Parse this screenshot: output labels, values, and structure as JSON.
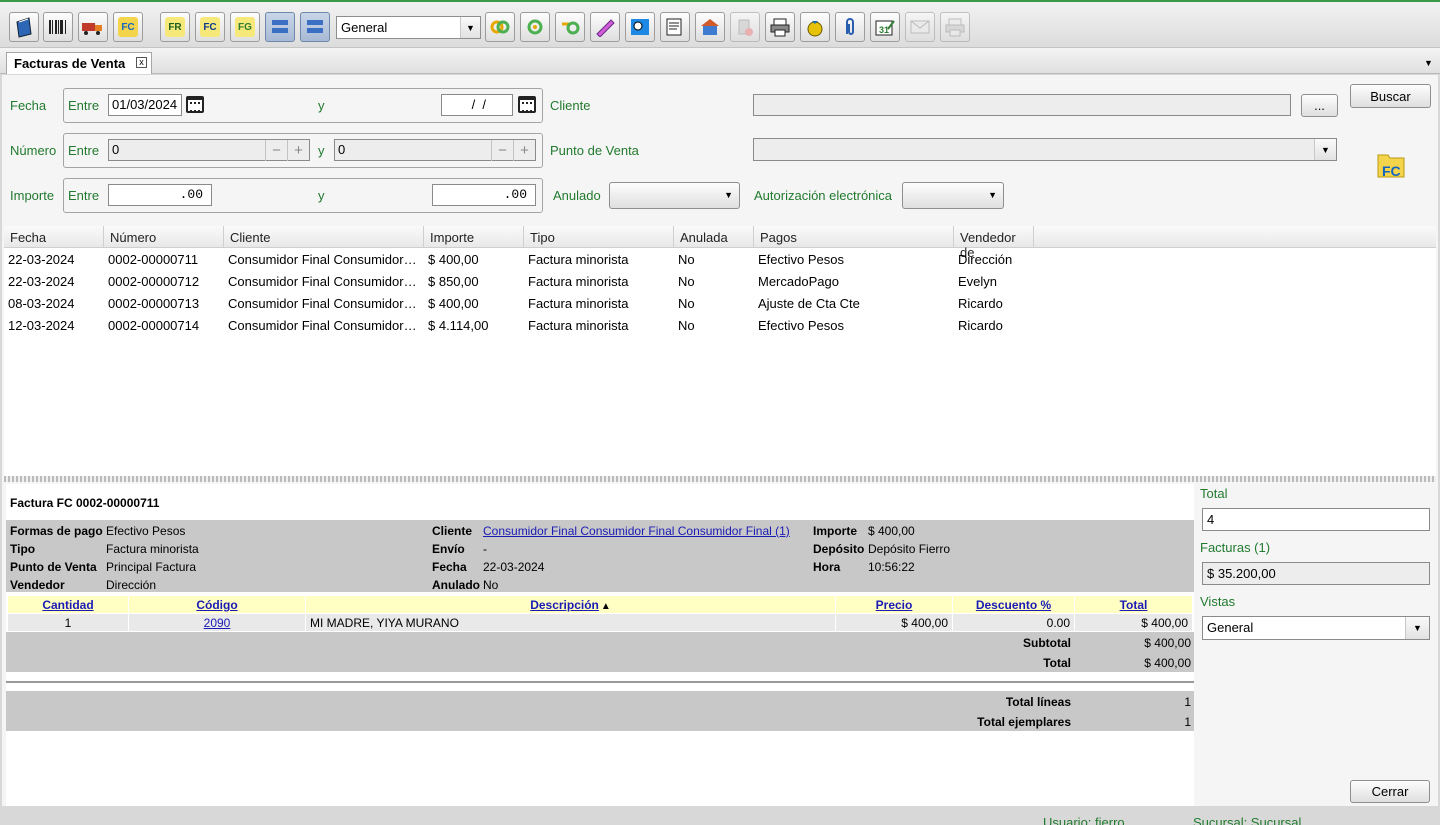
{
  "toolbar": {
    "buttons": [
      "notebook-icon",
      "barcode-icon",
      "delivery-truck-icon",
      "fc-folder-icon",
      "fr-icon",
      "fc-icon",
      "fg-icon",
      "list-view-icon",
      "list-view-alt-icon",
      "rings-icon",
      "green-circle-icon",
      "green-link-icon",
      "pen-icon",
      "map-search-icon",
      "print-preview-icon",
      "warehouse-icon",
      "delete-disabled-icon",
      "printer-icon",
      "moneybag-icon",
      "paperclip-icon",
      "calendar-edit-icon",
      "mail-disabled-icon",
      "printer-disabled-icon"
    ],
    "fr": "FR",
    "fc": "FC",
    "fg": "FG",
    "view_select": "General"
  },
  "tab": {
    "title": "Facturas de Venta",
    "close": "x"
  },
  "filters": {
    "fecha_label": "Fecha",
    "entre": "Entre",
    "y": "y",
    "fecha_from": "01/03/2024",
    "fecha_to": " /  /",
    "cliente_label": "Cliente",
    "cliente_value": "",
    "ellipsis": "...",
    "buscar": "Buscar",
    "numero_label": "Número",
    "numero_from": "0",
    "numero_to": "0",
    "punto_label": "Punto de Venta",
    "punto_value": "",
    "importe_label": "Importe",
    "importe_from": ".00",
    "importe_to": ".00",
    "anulado_label": "Anulado",
    "anulado_value": "",
    "autorizacion_label": "Autorización electrónica",
    "autorizacion_value": "",
    "fc_badge": "FC"
  },
  "grid": {
    "headers": [
      "Fecha",
      "Número",
      "Cliente",
      "Importe",
      "Tipo",
      "Anulada",
      "Pagos",
      "Vendedor de"
    ],
    "rows": [
      [
        "22-03-2024",
        "0002-00000711",
        "Consumidor Final Consumidor Final Consumidor Final",
        "$ 400,00",
        "Factura minorista",
        "No",
        "Efectivo Pesos",
        "Dirección"
      ],
      [
        "22-03-2024",
        "0002-00000712",
        "Consumidor Final Consumidor Final Consumidor Final",
        "$ 850,00",
        "Factura minorista",
        "No",
        "MercadoPago",
        "Evelyn"
      ],
      [
        "08-03-2024",
        "0002-00000713",
        "Consumidor Final Consumidor Final Consumidor Final",
        "$ 400,00",
        "Factura minorista",
        "No",
        "Ajuste de Cta Cte",
        "Ricardo"
      ],
      [
        "12-03-2024",
        "0002-00000714",
        "Consumidor Final Consumidor Final Consumidor Final",
        "$ 4.114,00",
        "Factura minorista",
        "No",
        "Efectivo Pesos",
        "Ricardo"
      ]
    ]
  },
  "detail": {
    "title": "Factura FC 0002-00000711",
    "formas_label": "Formas de pago",
    "formas": "Efectivo Pesos",
    "tipo_label": "Tipo",
    "tipo": "Factura minorista",
    "punto_label": "Punto de Venta",
    "punto": "Principal Factura",
    "vendedor_label": "Vendedor",
    "vendedor": "Dirección",
    "cliente_label": "Cliente",
    "cliente": "Consumidor Final Consumidor Final Consumidor Final (1)",
    "envio_label": "Envío",
    "envio": "-",
    "fecha_label": "Fecha",
    "fecha": "22-03-2024",
    "anulado_label": "Anulado",
    "anulado": "No",
    "importe_label": "Importe",
    "importe": "$ 400,00",
    "deposito_label": "Depósito",
    "deposito": "Depósito Fierro",
    "hora_label": "Hora",
    "hora": "10:56:22",
    "items_headers": [
      "Cantidad",
      "Código",
      "Descripción",
      "Precio",
      "Descuento %",
      "Total"
    ],
    "items": [
      [
        "1",
        "2090",
        "MI MADRE, YIYA MURANO",
        "$ 400,00",
        "0.00",
        "$ 400,00"
      ]
    ],
    "sort_arrow": "▲",
    "subtotal_label": "Subtotal",
    "subtotal": "$ 400,00",
    "total_label": "Total",
    "total": "$ 400,00",
    "total_lineas_label": "Total líneas",
    "total_lineas": "1",
    "total_ejemplares_label": "Total ejemplares",
    "total_ejemplares": "1"
  },
  "side": {
    "total_label": "Total",
    "total_value": "4",
    "facturas_label": "Facturas (1)",
    "facturas_value": "$ 35.200,00",
    "vistas_label": "Vistas",
    "vistas_value": "General",
    "cerrar": "Cerrar"
  },
  "status": {
    "usuario": "Usuario: fierro",
    "sucursal": "Sucursal: Sucursal"
  },
  "colors": {
    "accent": "#217a2e",
    "link": "#1a1ab5",
    "header_yellow": "#ffffc4",
    "grey_band": "#c8c8c8"
  }
}
